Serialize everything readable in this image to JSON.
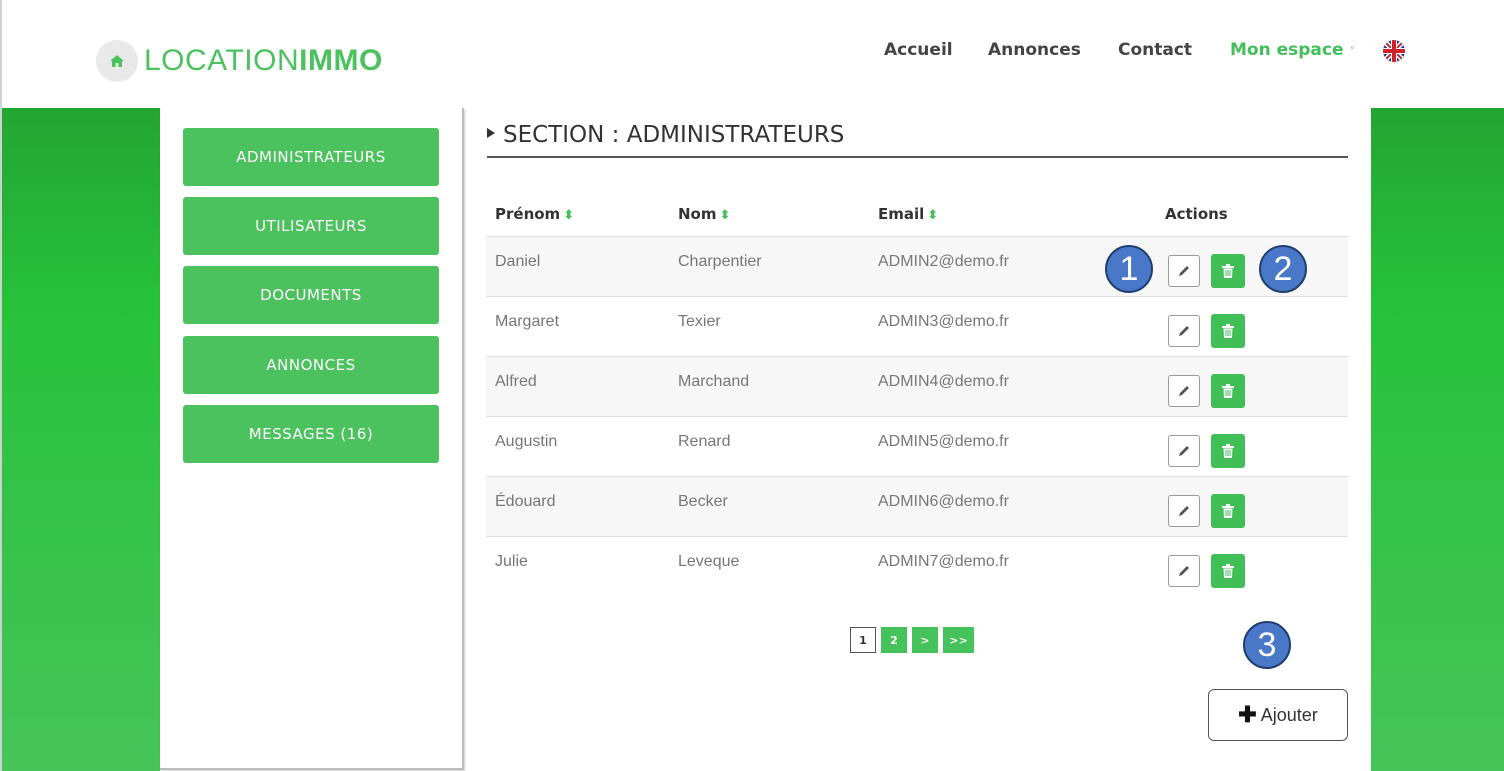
{
  "header": {
    "logo_light": "LOCATION",
    "logo_bold": "IMMO",
    "nav": [
      {
        "label": "Accueil"
      },
      {
        "label": "Annonces"
      },
      {
        "label": "Contact"
      },
      {
        "label": "Mon espace"
      }
    ],
    "dropdown_chevron": "˅",
    "language_flag": "uk-flag-icon"
  },
  "sidebar": {
    "items": [
      {
        "label": "ADMINISTRATEURS"
      },
      {
        "label": "UTILISATEURS"
      },
      {
        "label": "DOCUMENTS"
      },
      {
        "label": "ANNONCES"
      },
      {
        "label": "MESSAGES (16)"
      }
    ]
  },
  "section": {
    "title": "SECTION : ADMINISTRATEURS"
  },
  "table": {
    "headers": {
      "prenom": "Prénom",
      "nom": "Nom",
      "email": "Email",
      "actions": "Actions"
    },
    "sort_glyph": "⬍",
    "rows": [
      {
        "prenom": "Daniel",
        "nom": "Charpentier",
        "email": "ADMIN2@demo.fr"
      },
      {
        "prenom": "Margaret",
        "nom": "Texier",
        "email": "ADMIN3@demo.fr"
      },
      {
        "prenom": "Alfred",
        "nom": "Marchand",
        "email": "ADMIN4@demo.fr"
      },
      {
        "prenom": "Augustin",
        "nom": "Renard",
        "email": "ADMIN5@demo.fr"
      },
      {
        "prenom": "Édouard",
        "nom": "Becker",
        "email": "ADMIN6@demo.fr"
      },
      {
        "prenom": "Julie",
        "nom": "Leveque",
        "email": "ADMIN7@demo.fr"
      }
    ]
  },
  "pagination": {
    "current": "1",
    "page2": "2",
    "next": ">",
    "last": ">>"
  },
  "add_button": {
    "label": "Ajouter"
  },
  "callouts": {
    "one": "1",
    "two": "2",
    "three": "3"
  },
  "colors": {
    "brand_green": "#4cc25f",
    "callout_blue": "#4a78c8"
  }
}
